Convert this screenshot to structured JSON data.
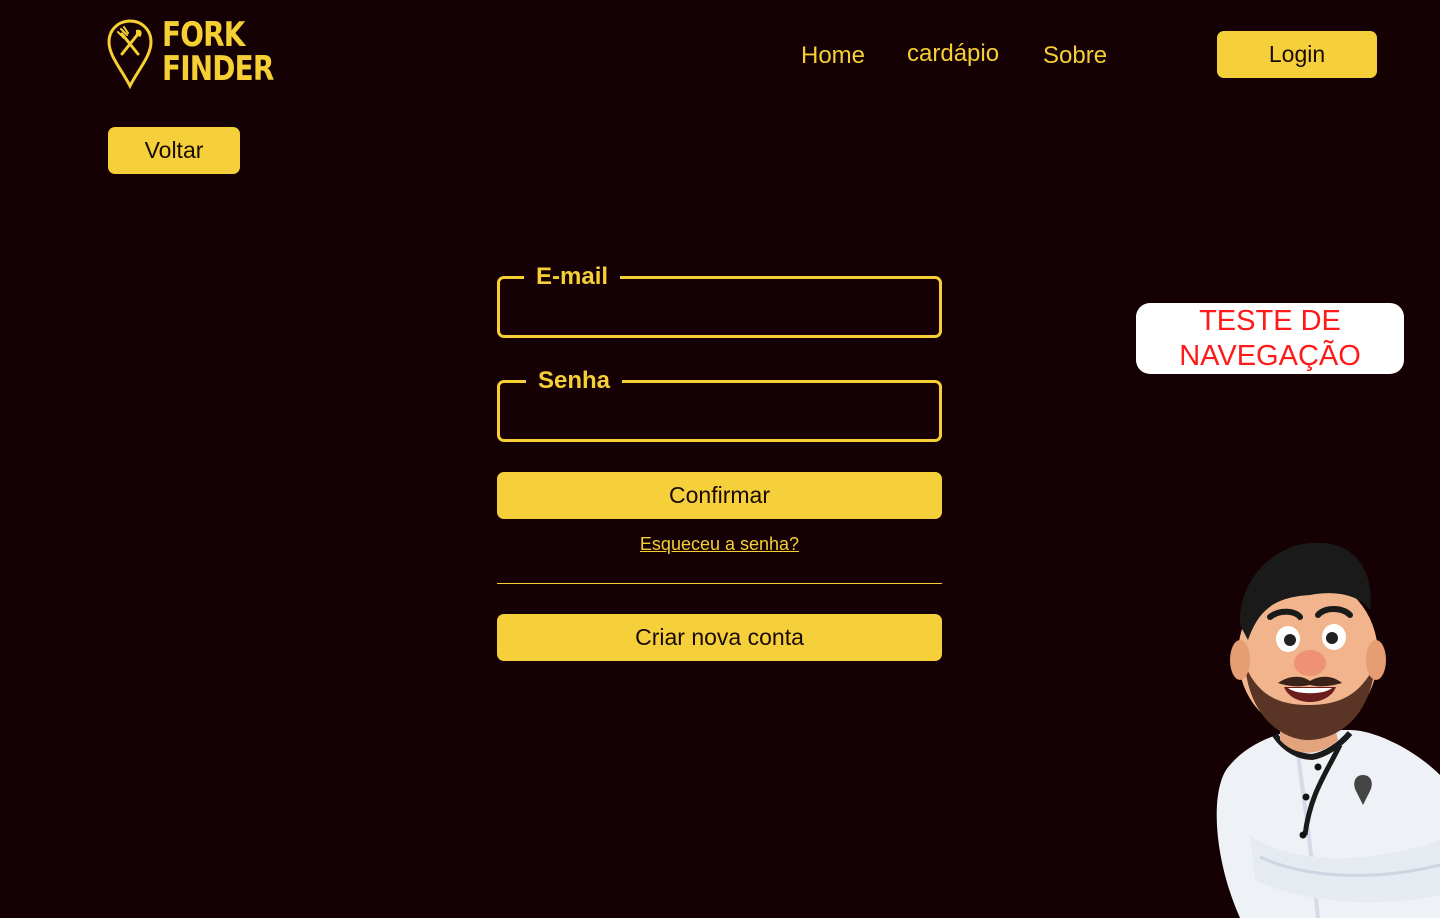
{
  "brand": {
    "logo_line1": "FORK",
    "logo_line2": "FINDER"
  },
  "nav": {
    "home": "Home",
    "cardapio": "cardápio",
    "sobre": "Sobre",
    "login": "Login"
  },
  "back_button": "Voltar",
  "form": {
    "email_label": "E-mail",
    "email_value": "",
    "password_label": "Senha",
    "password_value": "",
    "confirm_button": "Confirmar",
    "forgot_link": "Esqueceu a senha?",
    "create_account_button": "Criar nova conta"
  },
  "badge": {
    "line1": "TESTE DE",
    "line2": "NAVEGAÇÃO"
  },
  "colors": {
    "background": "#150003",
    "accent": "#f5cf34",
    "badge_text": "#ff1a1a"
  },
  "icons": {
    "logo": "location-pin-fork-knife-icon",
    "chef": "chef-mascot-illustration"
  }
}
